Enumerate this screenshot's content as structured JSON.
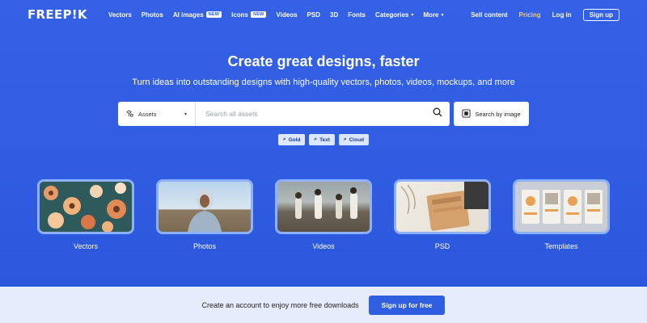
{
  "nav": {
    "logo": "FREEP!K",
    "links": [
      {
        "label": "Vectors"
      },
      {
        "label": "Photos"
      },
      {
        "label": "AI images",
        "badge": "NEW"
      },
      {
        "label": "Icons",
        "badge": "NEW"
      },
      {
        "label": "Videos"
      },
      {
        "label": "PSD"
      },
      {
        "label": "3D"
      },
      {
        "label": "Fonts"
      },
      {
        "label": "Categories",
        "dropdown": true
      },
      {
        "label": "More",
        "dropdown": true
      }
    ],
    "sell": "Sell content",
    "pricing": "Pricing",
    "login": "Log in",
    "signup": "Sign up"
  },
  "hero": {
    "title": "Create great designs, faster",
    "subtitle": "Turn ideas into outstanding designs with high-quality vectors, photos, videos, mockups, and more"
  },
  "search": {
    "type": "Assets",
    "placeholder": "Search all assets",
    "image_search": "Search by image"
  },
  "chips": [
    "Gold",
    "Text",
    "Cloud"
  ],
  "categories": [
    {
      "label": "Vectors"
    },
    {
      "label": "Photos"
    },
    {
      "label": "Videos"
    },
    {
      "label": "PSD"
    },
    {
      "label": "Templates"
    }
  ],
  "banner": {
    "text": "Create an account to enjoy more free downloads",
    "button": "Sign up for free"
  },
  "colors": {
    "brand": "#2f5fe0",
    "pricing": "#f7c97a",
    "banner_bg": "#e6ecfb"
  }
}
